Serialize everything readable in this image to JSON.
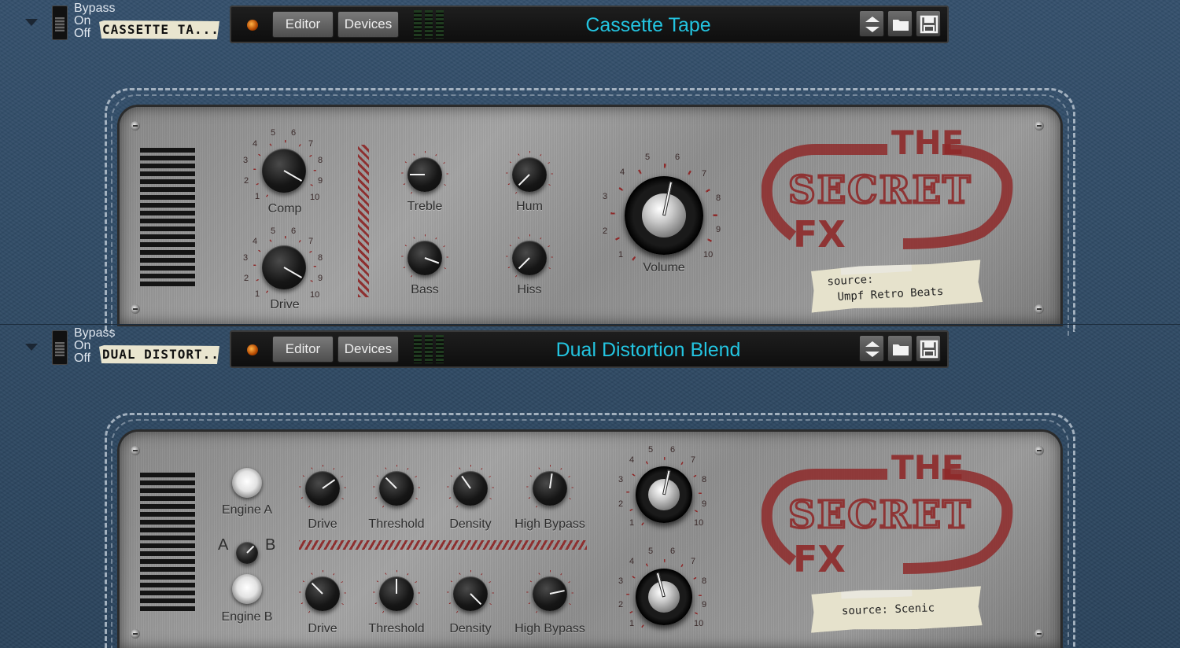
{
  "header": {
    "mode_labels": [
      "Bypass",
      "On",
      "Off"
    ],
    "toolbar": {
      "editor_label": "Editor",
      "devices_label": "Devices"
    }
  },
  "devices": [
    {
      "tape_label": "CASSETTE TA...",
      "preset_name": "Cassette Tape",
      "knobs": {
        "comp": "Comp",
        "drive": "Drive",
        "treble": "Treble",
        "bass": "Bass",
        "hum": "Hum",
        "hiss": "Hiss",
        "volume": "Volume"
      },
      "logo": {
        "the": "THE",
        "secret": "SECRET",
        "fx": "FX"
      },
      "source_line1": "source:",
      "source_line2": "Umpf Retro Beats"
    },
    {
      "tape_label": "DUAL DISTORT...",
      "preset_name": "Dual Distortion Blend",
      "engines": {
        "a": "Engine A",
        "b": "Engine B",
        "a_letter": "A",
        "b_letter": "B"
      },
      "row_a": {
        "drive": "Drive",
        "threshold": "Threshold",
        "density": "Density",
        "high_bypass": "High Bypass"
      },
      "row_b": {
        "drive": "Drive",
        "threshold": "Threshold",
        "density": "Density",
        "high_bypass": "High Bypass"
      },
      "logo": {
        "the": "THE",
        "secret": "SECRET",
        "fx": "FX"
      },
      "source_line1": "source: Scenic"
    }
  ],
  "scale_ticks": [
    "1",
    "2",
    "3",
    "4",
    "5",
    "6",
    "7",
    "8",
    "9",
    "10"
  ],
  "colors": {
    "accent_cyan": "#23c4e0",
    "logo_red": "#8e2a2a",
    "leather_blue": "#2d4863"
  }
}
